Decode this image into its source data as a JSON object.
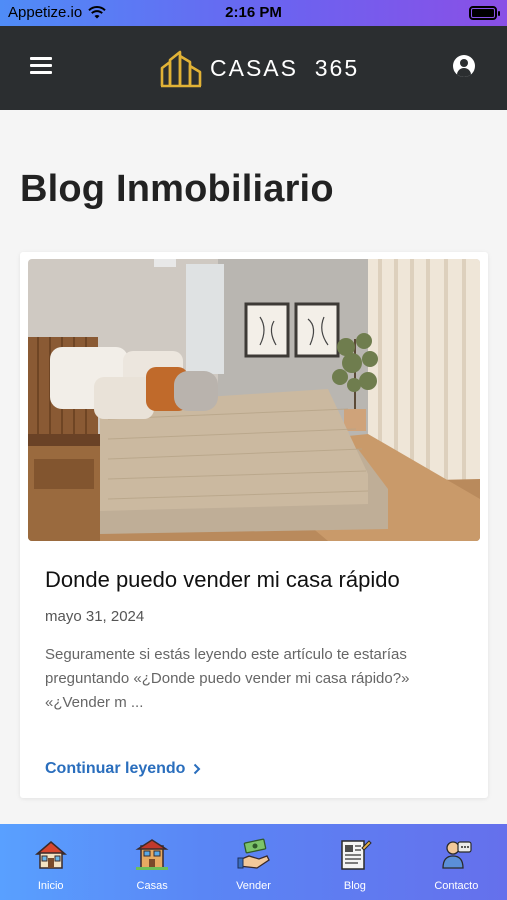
{
  "status_bar": {
    "carrier": "Appetize.io",
    "time": "2:16 PM"
  },
  "header": {
    "logo_text": "CASAS  365"
  },
  "page": {
    "title": "Blog Inmobiliario"
  },
  "post": {
    "title": "Donde puedo vender mi casa rápido",
    "date": "mayo 31, 2024",
    "excerpt": "Seguramente si estás leyendo este artículo te estarías preguntando «¿Donde puedo vender mi casa rápido?» «¿Vender m ...",
    "link_label": "Continuar leyendo"
  },
  "bottom_nav": [
    {
      "label": "Inicio",
      "icon": "house-icon"
    },
    {
      "label": "Casas",
      "icon": "houses-icon"
    },
    {
      "label": "Vender",
      "icon": "money-hand-icon"
    },
    {
      "label": "Blog",
      "icon": "newspaper-icon"
    },
    {
      "label": "Contacto",
      "icon": "contact-icon"
    }
  ],
  "colors": {
    "header_bg": "#2b2e30",
    "accent_link": "#2a6ebd",
    "logo_gold": "#e1b236"
  }
}
